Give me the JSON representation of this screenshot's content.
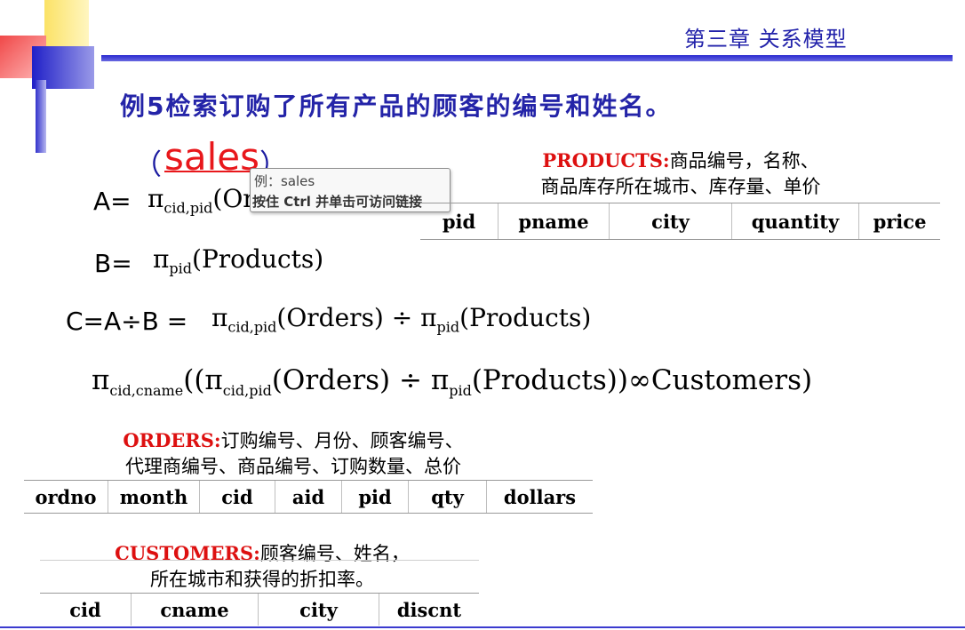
{
  "header": {
    "chapter": "第三章 关系模型",
    "title": "例5检索订购了所有产品的顾客的编号和姓名。"
  },
  "annotation": {
    "paren_open": "（",
    "word": "sales",
    "paren_close": "）"
  },
  "tooltip": {
    "line1": "例：sales",
    "line2": "按住 Ctrl 并单击可访问链接"
  },
  "equations": {
    "a_label": "A=",
    "a_pi": "π",
    "a_sub": "cid,pid",
    "a_arg": "(Or",
    "b_label": "B=",
    "b_pi": "π",
    "b_sub": "pid",
    "b_arg": "(Products)",
    "c_label": "C=A÷B =",
    "c_pi1": "π",
    "c_sub1": "cid,pid",
    "c_arg1": "(Orders) ÷ ",
    "c_pi2": "π",
    "c_sub2": "pid",
    "c_arg2": "(Products)",
    "final_pi1": "π",
    "final_sub1": "cid,cname",
    "final_open": "((π",
    "final_sub2": "cid,pid",
    "final_mid": "(Orders) ÷ π",
    "final_sub3": "pid",
    "final_end": "(Products))∞Customers)"
  },
  "products": {
    "name": "PRODUCTS:",
    "desc1": "商品编号，名称、",
    "desc2": "商品库存所在城市、库存量、单价",
    "columns": [
      "pid",
      "pname",
      "city",
      "quantity",
      "price"
    ]
  },
  "orders": {
    "name": "ORDERS:",
    "desc1": "订购编号、月份、顾客编号、",
    "desc2": "代理商编号、商品编号、订购数量、总价",
    "columns": [
      "ordno",
      "month",
      "cid",
      "aid",
      "pid",
      "qty",
      "dollars"
    ]
  },
  "customers": {
    "name": "CUSTOMERS:",
    "desc1": "顾客编号、姓名，",
    "desc2": "所在城市和获得的折扣率。",
    "columns": [
      "cid",
      "cname",
      "city",
      "discnt"
    ]
  }
}
